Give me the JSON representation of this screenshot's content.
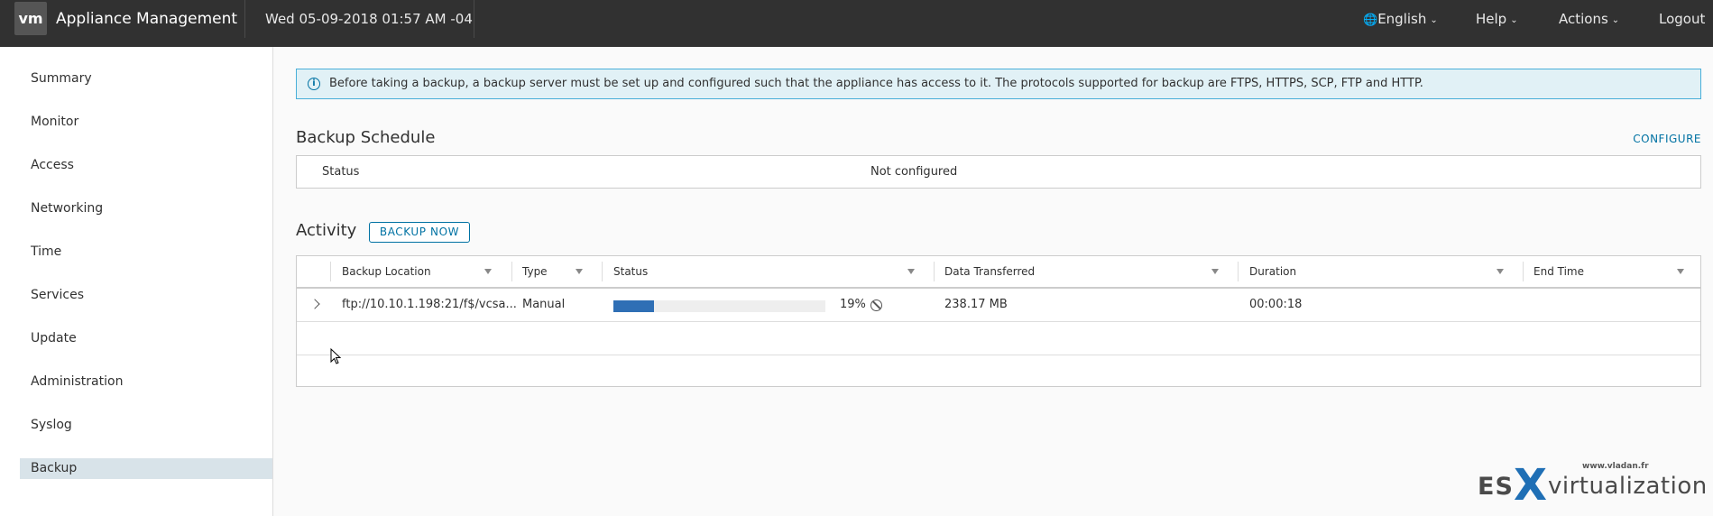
{
  "header": {
    "logo": "vm",
    "title": "Appliance Management",
    "datetime": "Wed 05-09-2018 01:57 AM -04",
    "nav": {
      "language": "English",
      "help": "Help",
      "actions": "Actions",
      "logout": "Logout"
    }
  },
  "sidebar": {
    "items": [
      {
        "label": "Summary"
      },
      {
        "label": "Monitor"
      },
      {
        "label": "Access"
      },
      {
        "label": "Networking"
      },
      {
        "label": "Time"
      },
      {
        "label": "Services"
      },
      {
        "label": "Update"
      },
      {
        "label": "Administration"
      },
      {
        "label": "Syslog"
      },
      {
        "label": "Backup"
      }
    ],
    "active": "Backup"
  },
  "info_banner": {
    "text": "Before taking a backup, a backup server must be set up and configured such that the appliance has access to it. The protocols supported for backup are FTPS, HTTPS, SCP, FTP and HTTP."
  },
  "schedule": {
    "title": "Backup Schedule",
    "configure_label": "CONFIGURE",
    "status_key": "Status",
    "status_value": "Not configured"
  },
  "activity": {
    "title": "Activity",
    "backup_now_label": "BACKUP NOW",
    "columns": [
      "Backup Location",
      "Type",
      "Status",
      "Data Transferred",
      "Duration",
      "End Time"
    ],
    "rows": [
      {
        "location": "ftp://10.10.1.198:21/f$/vcsa...",
        "type": "Manual",
        "progress_percent": 19,
        "progress_label": "19%",
        "data_transferred": "238.17 MB",
        "duration": "00:00:18",
        "end_time": ""
      }
    ]
  },
  "watermark": {
    "url": "www.vladan.fr",
    "brand_es": "ES",
    "brand_x": "X",
    "brand_rest": "virtualization"
  },
  "colors": {
    "header_bg": "#313131",
    "accent": "#0072a3",
    "progress": "#2f6fb5",
    "banner_bg": "#e1f1f6",
    "active_nav": "#d8e3e9"
  }
}
